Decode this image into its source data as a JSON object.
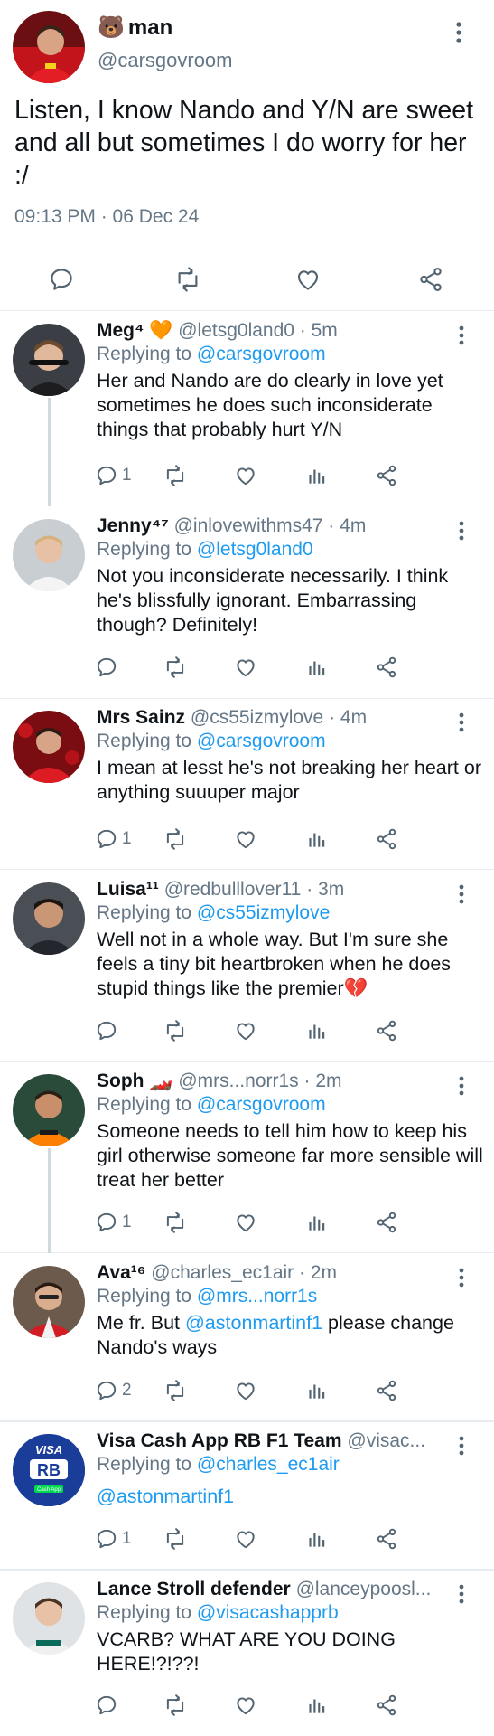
{
  "main_tweet": {
    "name_emoji": "🐻",
    "name": "man",
    "handle": "@carsgovroom",
    "text": "Listen, I know Nando and Y/N are sweet and all but sometimes I do worry for her :/",
    "timestamp": "09:13 PM · 06 Dec 24"
  },
  "replies": [
    {
      "name": "Meg⁴",
      "name_emoji": "🧡",
      "meta": "@letsg0land0 · 5m",
      "replying_label": "Replying to",
      "replying_to": "@carsgovroom",
      "body": "Her and Nando are do clearly in love yet sometimes he does such inconsiderate things that probably hurt Y/N",
      "reply_count": "1"
    },
    {
      "name": "Jenny⁴⁷",
      "meta": "@inlovewithms47 · 4m",
      "replying_label": "Replying to",
      "replying_to": "@letsg0land0",
      "body": "Not you inconsiderate necessarily. I think he's blissfully ignorant. Embarrassing though? Definitely!",
      "reply_count": ""
    },
    {
      "name": "Mrs Sainz",
      "meta": "@cs55izmylove · 4m",
      "replying_label": "Replying to",
      "replying_to": "@carsgovroom",
      "body": "I mean at lesst he's not breaking her heart or anything suuuper major",
      "reply_count": "1"
    },
    {
      "name": "Luisa¹¹",
      "meta": "@redbulllover11 · 3m",
      "replying_label": "Replying to",
      "replying_to": "@cs55izmylove",
      "body": "Well not in a whole way. But I'm sure she feels a tiny bit heartbroken when he does stupid things like the premier💔",
      "reply_count": ""
    },
    {
      "name": "Soph",
      "name_emoji": "🏎️",
      "meta": "@mrs...norr1s · 2m",
      "replying_label": "Replying to",
      "replying_to": "@carsgovroom",
      "body": "Someone needs to tell him how to keep his girl otherwise someone far more sensible will treat her better",
      "reply_count": "1"
    },
    {
      "name": "Ava¹⁶",
      "meta": "@charles_ec1air · 2m",
      "replying_label": "Replying to",
      "replying_to": "@mrs...norr1s",
      "body_pre": "Me fr. But ",
      "body_mention": "@astonmartinf1",
      "body_post": " please change Nando's ways",
      "reply_count": "2"
    },
    {
      "name": "Visa Cash App RB F1 Team",
      "meta": "@visac...",
      "replying_label": "Replying to",
      "replying_to": "@charles_ec1air",
      "body_mention": "@astonmartinf1",
      "reply_count": "1",
      "avatar_text_top": "VISA",
      "avatar_text_mid": "RB",
      "avatar_text_small": "Cash App"
    },
    {
      "name": "Lance Stroll defender",
      "meta": "@lanceypoosl...",
      "replying_label": "Replying to",
      "replying_to": "@visacashapprb",
      "body": "VCARB? WHAT ARE YOU DOING HERE!?!??!",
      "reply_count": ""
    }
  ],
  "icons": [
    "reply-icon",
    "retweet-icon",
    "like-icon",
    "analytics-icon",
    "share-icon",
    "more-icon"
  ],
  "colors": {
    "link": "#1d9bf0",
    "muted": "#657786",
    "divider": "#e6ecf0",
    "text": "#0f1419"
  }
}
